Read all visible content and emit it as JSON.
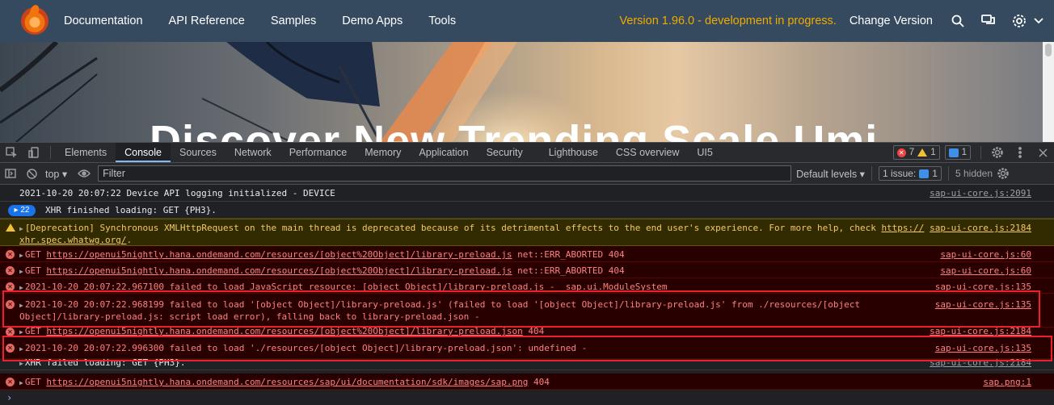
{
  "site_nav": {
    "links": [
      "Documentation",
      "API Reference",
      "Samples",
      "Demo Apps",
      "Tools"
    ],
    "version_notice": "Version 1.96.0 - development in progress.",
    "change_version": "Change Version",
    "icons": [
      "search-icon",
      "feedback-icon",
      "settings-icon",
      "chevron-down-icon"
    ],
    "accent_color": "#f0ab00"
  },
  "hero": {
    "title": "Discover New Trending Scale Umi"
  },
  "devtools": {
    "tabs": [
      "Elements",
      "Console",
      "Sources",
      "Network",
      "Performance",
      "Memory",
      "Application",
      "Security",
      "Lighthouse",
      "CSS overview",
      "UI5"
    ],
    "active_tab": "Console",
    "error_count": "7",
    "warning_count": "1",
    "issue_count": "1",
    "toolbar": {
      "context": "top",
      "filter_placeholder": "Filter",
      "levels": "Default levels",
      "issues_label": "1 issue:",
      "issues_badge": "1",
      "hidden": "5 hidden"
    }
  },
  "console": {
    "rows": [
      {
        "type": "info",
        "text": "2021-10-20 20:07:22 Device API logging initialized - DEVICE",
        "src": "sap-ui-core.js:2091"
      },
      {
        "type": "info",
        "repeat": "22",
        "text": "XHR finished loading: GET {PH3}.",
        "src": ""
      },
      {
        "type": "warn",
        "text1": "[Deprecation] Synchronous XMLHttpRequest on the main thread is deprecated because of its detrimental effects to the end user's experience. For more help, check ",
        "link1": "https://",
        "link2": "xhr.spec.whatwg.org/",
        "text2": ".",
        "src": "sap-ui-core.js:2184"
      },
      {
        "type": "err",
        "prefix": "GET ",
        "link": "https://openui5nightly.hana.ondemand.com/resources/[object%20Object]/library-preload.js",
        "suffix": " net::ERR_ABORTED 404",
        "src": "sap-ui-core.js:60"
      },
      {
        "type": "err",
        "prefix": "GET ",
        "link": "https://openui5nightly.hana.ondemand.com/resources/[object%20Object]/library-preload.js",
        "suffix": " net::ERR_ABORTED 404",
        "src": "sap-ui-core.js:60"
      },
      {
        "type": "err",
        "text": "2021-10-20 20:07:22.967100 failed to load JavaScript resource: [object Object]/library-preload.js -  sap.ui.ModuleSystem",
        "src": "sap-ui-core.js:135"
      },
      {
        "type": "err",
        "line1": "2021-10-20 20:07:22.968199 failed to load '[object Object]/library-preload.js' (failed to load '[object Object]/library-preload.js' from ./resources/[object",
        "line2": "Object]/library-preload.js: script load error), falling back to library-preload.json -",
        "src": "sap-ui-core.js:135"
      },
      {
        "type": "err",
        "prefix": "GET ",
        "link": "https://openui5nightly.hana.ondemand.com/resources/[object%20Object]/library-preload.json",
        "suffix": " 404",
        "src": "sap-ui-core.js:2184"
      },
      {
        "type": "err",
        "text": "2021-10-20 20:07:22.996300 failed to load './resources/[object Object]/library-preload.json': undefined -",
        "src": "sap-ui-core.js:135"
      },
      {
        "type": "info",
        "text": "XHR failed loading: GET {PH3}.",
        "src": "sap-ui-core.js:2184"
      },
      {
        "type": "err",
        "prefix": "GET ",
        "link": "https://openui5nightly.hana.ondemand.com/resources/sap/ui/documentation/sdk/images/sap.png",
        "suffix": " 404",
        "src": "sap.png:1"
      }
    ],
    "prompt": "›"
  }
}
